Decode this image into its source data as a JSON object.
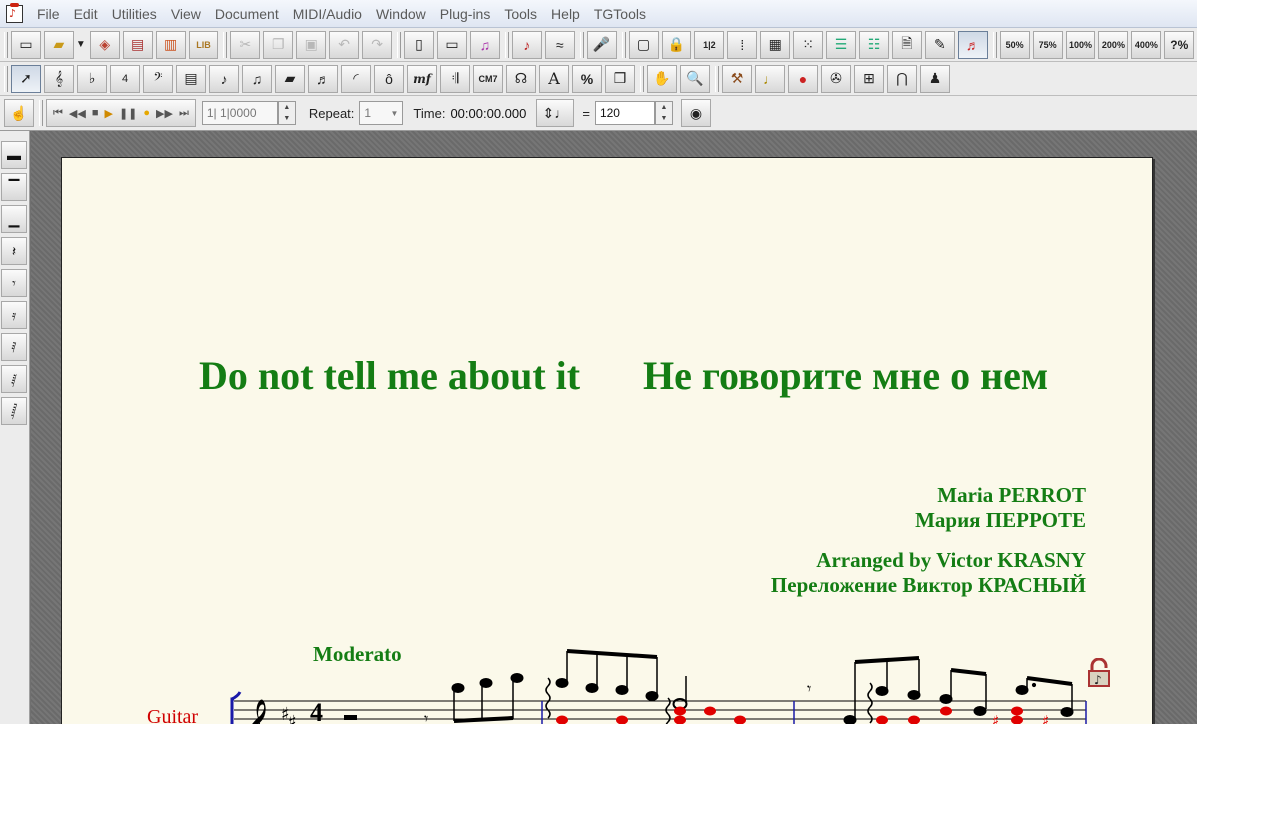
{
  "menu": [
    "File",
    "Edit",
    "Utilities",
    "View",
    "Document",
    "MIDI/Audio",
    "Window",
    "Plug-ins",
    "Tools",
    "Help",
    "TGTools"
  ],
  "toolbar1": {
    "zoom": [
      "50%",
      "75%",
      "100%",
      "200%",
      "400%",
      "?%"
    ]
  },
  "toolbar2": {
    "expression_label": "mf",
    "chord_label": "CM7",
    "text_label": "A",
    "percent_label": "%"
  },
  "transport": {
    "counter": "1| 1|0000",
    "repeat_label": "Repeat:",
    "repeat_value": "1",
    "time_label": "Time:",
    "time_value": "00:00:00.000",
    "equals": "=",
    "tempo_value": "120"
  },
  "score": {
    "title_en": "Do not tell me about it",
    "title_ru": "Не говорите мне о нем",
    "composer_en": "Maria PERROT",
    "composer_ru": "Мария ПЕРРОТЕ",
    "arranger_en": "Arranged by Victor KRASNY",
    "arranger_ru": "Переложение Виктор КРАСНЫЙ",
    "tempo_marking": "Moderato",
    "instrument": "Guitar",
    "time_signature": "4"
  },
  "colors": {
    "title_green": "#147d14",
    "instrument_red": "#d00000",
    "note_red": "#e00000",
    "staff_blue": "#1a1aa8"
  }
}
